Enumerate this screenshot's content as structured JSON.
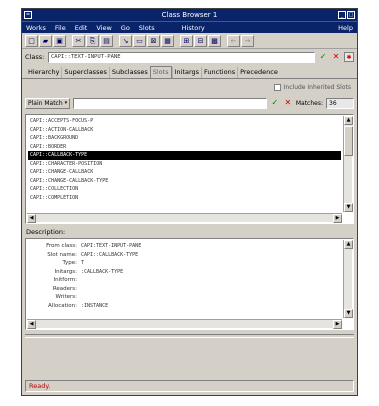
{
  "window": {
    "title": "Class Browser 1"
  },
  "menubar": [
    "Works",
    "File",
    "Edit",
    "View",
    "Go",
    "Slots",
    "",
    "",
    "History",
    "Help"
  ],
  "toolbar": {
    "icons": [
      "new-icon",
      "open-icon",
      "save-icon",
      "cut-icon",
      "copy-icon",
      "paste-icon",
      "arrow-icon",
      "select-icon",
      "delete-icon",
      "grid-icon",
      "tree-icon",
      "graph-icon",
      "back-icon",
      "forward-icon"
    ]
  },
  "class_row": {
    "label": "Class:",
    "value": "CAPI::TEXT-INPUT-PANE"
  },
  "tabs": [
    "Hierarchy",
    "Superclasses",
    "Subclasses",
    "Slots",
    "Initargs",
    "Functions",
    "Precedence"
  ],
  "active_tab": "Slots",
  "include_inherited": {
    "label": "Include Inherited Slots",
    "checked": false
  },
  "match": {
    "mode": "Plain Match",
    "value": "",
    "count_label": "Matches:",
    "count": "36"
  },
  "slots": [
    "CAPI::ACCEPTS-FOCUS-P",
    "CAPI::ACTION-CALLBACK",
    "CAPI::BACKGROUND",
    "CAPI::BORDER",
    "CAPI::CALLBACK-TYPE",
    "CAPI::CHARACTER-POSITION",
    "CAPI::CHANGE-CALLBACK",
    "CAPI::CHANGE-CALLBACK-TYPE",
    "CAPI::COLLECTION",
    "CAPI::COMPLETION"
  ],
  "selected_index": 4,
  "description": {
    "label": "Description:",
    "rows": [
      {
        "k": "From class:",
        "v": "CAPI:TEXT-INPUT-PANE"
      },
      {
        "k": "Slot name:",
        "v": "CAPI::CALLBACK-TYPE"
      },
      {
        "k": "Type:",
        "v": "T"
      },
      {
        "k": "Initargs:",
        "v": ":CALLBACK-TYPE"
      },
      {
        "k": "Initform:",
        "v": ""
      },
      {
        "k": "Readers:",
        "v": ""
      },
      {
        "k": "Writers:",
        "v": ""
      },
      {
        "k": "Allocation:",
        "v": ":INSTANCE"
      }
    ]
  },
  "status": "Ready."
}
